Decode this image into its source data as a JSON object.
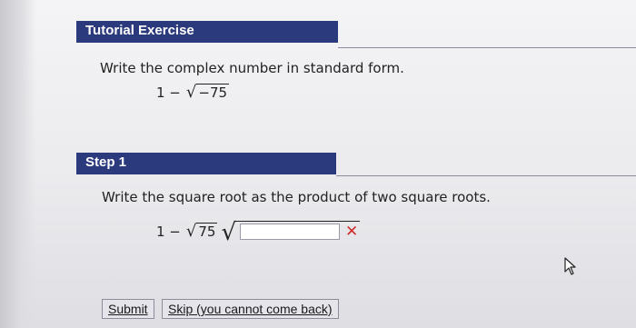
{
  "tutorial": {
    "header": "Tutorial Exercise",
    "prompt": "Write the complex number in standard form.",
    "expression": {
      "lead": "1 −",
      "radical_symbol": "√",
      "radicand": "−75"
    }
  },
  "step1": {
    "header": "Step 1",
    "prompt": "Write the square root as the product of two square roots.",
    "expression": {
      "lead": "1 −",
      "radical_symbol": "√",
      "radicand": "75",
      "answer_radical_symbol": "√"
    },
    "answer_value": "",
    "status": "✕"
  },
  "buttons": {
    "submit": "Submit",
    "skip": "Skip (you cannot come back)"
  },
  "icons": [
    "square-root-icon",
    "incorrect-x-icon",
    "mouse-pointer-icon"
  ],
  "colors": {
    "header_bg": "#2a3a7d",
    "header_text": "#ffffff",
    "error": "#cf2b2b",
    "button_bg": "#e4e4ea"
  }
}
